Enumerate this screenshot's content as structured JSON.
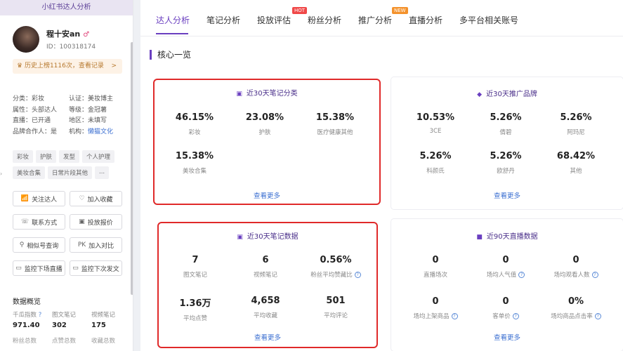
{
  "sidebar": {
    "header": "小红书达人分析",
    "profile": {
      "name": "程十安an",
      "badge": "♂",
      "id": "ID：100318174"
    },
    "history": {
      "text": "历史上榜1116次，查看记录",
      "chevron": ">"
    },
    "info": [
      [
        "分类：彩妆",
        "认证：美妆博主"
      ],
      [
        "属性：头部达人",
        "等级：金冠薯"
      ],
      [
        "直播：已开通",
        "地区：未填写"
      ],
      [
        "品牌合作人：是",
        "机构：",
        "懒猫文化"
      ]
    ],
    "tags": [
      "彩妆",
      "护肤",
      "发型",
      "个人护理",
      "美妆合集",
      "日常片段其他",
      "..."
    ],
    "buttons": [
      {
        "icon": "📶",
        "label": "关注达人"
      },
      {
        "icon": "♡",
        "label": "加入收藏"
      },
      {
        "icon": "☏",
        "label": "联系方式"
      },
      {
        "icon": "▣",
        "label": "投放报价"
      },
      {
        "icon": "⚲",
        "label": "相似号查询"
      },
      {
        "icon": "PK",
        "label": "加入对比"
      },
      {
        "icon": "▭",
        "label": "监控下场直播"
      },
      {
        "icon": "▭",
        "label": "监控下次发文"
      }
    ],
    "overview": {
      "title": "数据概览",
      "cols": [
        {
          "label": "千瓜指数",
          "value": "971.40"
        },
        {
          "label": "图文笔记",
          "value": "302"
        },
        {
          "label": "视频笔记",
          "value": "175"
        }
      ],
      "row2": [
        "粉丝总数",
        "点赞总数",
        "收藏总数"
      ]
    }
  },
  "tabs": [
    "达人分析",
    "笔记分析",
    "投放评估",
    "粉丝分析",
    "推广分析",
    "直播分析",
    "多平台相关账号"
  ],
  "tab_tags": {
    "hot": "HOT",
    "new": "NEW"
  },
  "section_title": "核心一览",
  "panels": {
    "note_category": {
      "title": "近30天笔记分类",
      "stats": [
        {
          "v": "46.15%",
          "l": "彩妆"
        },
        {
          "v": "23.08%",
          "l": "护肤"
        },
        {
          "v": "15.38%",
          "l": "医疗健康其他"
        },
        {
          "v": "15.38%",
          "l": "美妆合集"
        }
      ],
      "more": "查看更多"
    },
    "brands": {
      "title": "近30天推广品牌",
      "stats": [
        {
          "v": "10.53%",
          "l": "3CE"
        },
        {
          "v": "5.26%",
          "l": "倩碧"
        },
        {
          "v": "5.26%",
          "l": "阿玛尼"
        },
        {
          "v": "5.26%",
          "l": "科颜氏"
        },
        {
          "v": "5.26%",
          "l": "欧舒丹"
        },
        {
          "v": "68.42%",
          "l": "其他"
        }
      ],
      "more": "查看更多"
    },
    "note_data": {
      "title": "近30天笔记数据",
      "stats": [
        {
          "v": "7",
          "l": "图文笔记"
        },
        {
          "v": "6",
          "l": "视频笔记"
        },
        {
          "v": "0.56%",
          "l": "粉丝平均赞藏比"
        },
        {
          "v": "1.36万",
          "l": "平均点赞"
        },
        {
          "v": "4,658",
          "l": "平均收藏"
        },
        {
          "v": "501",
          "l": "平均评论"
        }
      ],
      "more": "查看更多"
    },
    "live": {
      "title": "近90天直播数据",
      "stats": [
        {
          "v": "0",
          "l": "直播场次"
        },
        {
          "v": "0",
          "l": "场均人气值"
        },
        {
          "v": "0",
          "l": "场均观看人数"
        },
        {
          "v": "0",
          "l": "场均上架商品"
        },
        {
          "v": "0",
          "l": "客单价"
        },
        {
          "v": "0%",
          "l": "场均商品点击率"
        }
      ],
      "more": "查看更多"
    }
  },
  "help_glyph": "?",
  "colors": {
    "accent": "#6a3fc0",
    "highlight_border": "#e02a2a",
    "link": "#3b6fd1"
  }
}
